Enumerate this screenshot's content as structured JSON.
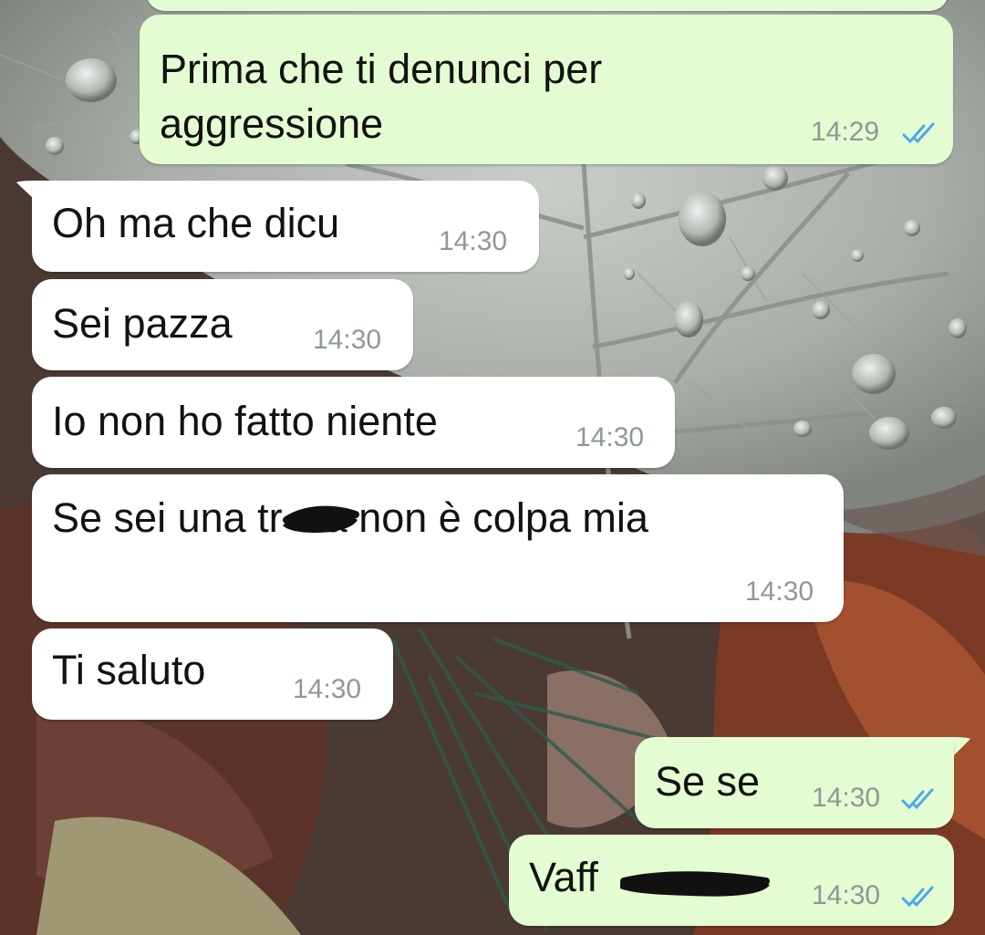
{
  "chat": {
    "messages": [
      {
        "id": "m1",
        "direction": "outgoing",
        "lines": [
          "Prima che ti denunci per",
          "aggressione"
        ],
        "time": "14:29",
        "status": "read"
      },
      {
        "id": "m2",
        "direction": "incoming",
        "text": "Oh ma che dicu",
        "time": "14:30"
      },
      {
        "id": "m3",
        "direction": "incoming",
        "text": "Sei pazza",
        "time": "14:30"
      },
      {
        "id": "m4",
        "direction": "incoming",
        "text": "Io non ho fatto niente",
        "time": "14:30"
      },
      {
        "id": "m5",
        "direction": "incoming",
        "text_before": "Se sei una ",
        "redacted_word_visible": "tr",
        "redacted_word_tail": "a",
        "text_after": " non è colpa mia",
        "time": "14:30"
      },
      {
        "id": "m6",
        "direction": "incoming",
        "text": "Ti saluto",
        "time": "14:30"
      },
      {
        "id": "m7",
        "direction": "outgoing",
        "text": "Se se",
        "time": "14:30",
        "status": "read"
      },
      {
        "id": "m8",
        "direction": "outgoing",
        "redacted_word_visible": "Vaff",
        "time": "14:30",
        "status": "read"
      }
    ]
  },
  "colors": {
    "outgoing_bubble": "#e3fcd1",
    "incoming_bubble": "#ffffff",
    "read_ticks": "#4fa8e8",
    "timestamp": "#8e9896"
  },
  "icons": {
    "read_status": "double-check-icon"
  }
}
